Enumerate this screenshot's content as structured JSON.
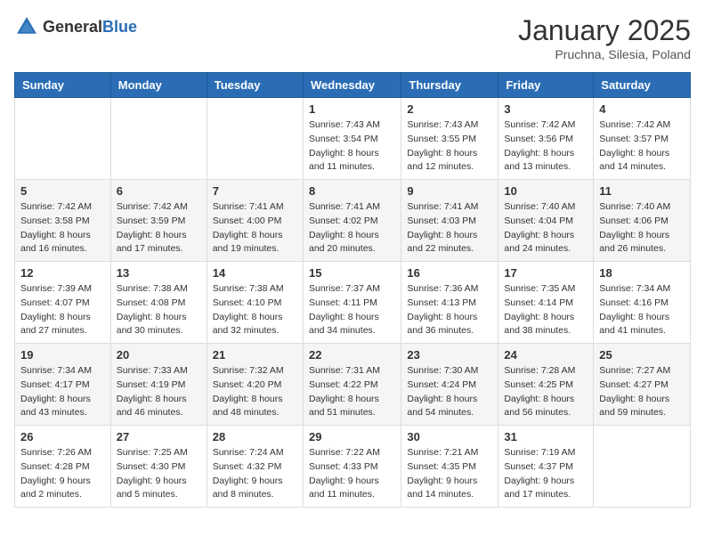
{
  "header": {
    "logo_general": "General",
    "logo_blue": "Blue",
    "title": "January 2025",
    "location": "Pruchna, Silesia, Poland"
  },
  "weekdays": [
    "Sunday",
    "Monday",
    "Tuesday",
    "Wednesday",
    "Thursday",
    "Friday",
    "Saturday"
  ],
  "weeks": [
    [
      {
        "day": "",
        "info": ""
      },
      {
        "day": "",
        "info": ""
      },
      {
        "day": "",
        "info": ""
      },
      {
        "day": "1",
        "info": "Sunrise: 7:43 AM\nSunset: 3:54 PM\nDaylight: 8 hours\nand 11 minutes."
      },
      {
        "day": "2",
        "info": "Sunrise: 7:43 AM\nSunset: 3:55 PM\nDaylight: 8 hours\nand 12 minutes."
      },
      {
        "day": "3",
        "info": "Sunrise: 7:42 AM\nSunset: 3:56 PM\nDaylight: 8 hours\nand 13 minutes."
      },
      {
        "day": "4",
        "info": "Sunrise: 7:42 AM\nSunset: 3:57 PM\nDaylight: 8 hours\nand 14 minutes."
      }
    ],
    [
      {
        "day": "5",
        "info": "Sunrise: 7:42 AM\nSunset: 3:58 PM\nDaylight: 8 hours\nand 16 minutes."
      },
      {
        "day": "6",
        "info": "Sunrise: 7:42 AM\nSunset: 3:59 PM\nDaylight: 8 hours\nand 17 minutes."
      },
      {
        "day": "7",
        "info": "Sunrise: 7:41 AM\nSunset: 4:00 PM\nDaylight: 8 hours\nand 19 minutes."
      },
      {
        "day": "8",
        "info": "Sunrise: 7:41 AM\nSunset: 4:02 PM\nDaylight: 8 hours\nand 20 minutes."
      },
      {
        "day": "9",
        "info": "Sunrise: 7:41 AM\nSunset: 4:03 PM\nDaylight: 8 hours\nand 22 minutes."
      },
      {
        "day": "10",
        "info": "Sunrise: 7:40 AM\nSunset: 4:04 PM\nDaylight: 8 hours\nand 24 minutes."
      },
      {
        "day": "11",
        "info": "Sunrise: 7:40 AM\nSunset: 4:06 PM\nDaylight: 8 hours\nand 26 minutes."
      }
    ],
    [
      {
        "day": "12",
        "info": "Sunrise: 7:39 AM\nSunset: 4:07 PM\nDaylight: 8 hours\nand 27 minutes."
      },
      {
        "day": "13",
        "info": "Sunrise: 7:38 AM\nSunset: 4:08 PM\nDaylight: 8 hours\nand 30 minutes."
      },
      {
        "day": "14",
        "info": "Sunrise: 7:38 AM\nSunset: 4:10 PM\nDaylight: 8 hours\nand 32 minutes."
      },
      {
        "day": "15",
        "info": "Sunrise: 7:37 AM\nSunset: 4:11 PM\nDaylight: 8 hours\nand 34 minutes."
      },
      {
        "day": "16",
        "info": "Sunrise: 7:36 AM\nSunset: 4:13 PM\nDaylight: 8 hours\nand 36 minutes."
      },
      {
        "day": "17",
        "info": "Sunrise: 7:35 AM\nSunset: 4:14 PM\nDaylight: 8 hours\nand 38 minutes."
      },
      {
        "day": "18",
        "info": "Sunrise: 7:34 AM\nSunset: 4:16 PM\nDaylight: 8 hours\nand 41 minutes."
      }
    ],
    [
      {
        "day": "19",
        "info": "Sunrise: 7:34 AM\nSunset: 4:17 PM\nDaylight: 8 hours\nand 43 minutes."
      },
      {
        "day": "20",
        "info": "Sunrise: 7:33 AM\nSunset: 4:19 PM\nDaylight: 8 hours\nand 46 minutes."
      },
      {
        "day": "21",
        "info": "Sunrise: 7:32 AM\nSunset: 4:20 PM\nDaylight: 8 hours\nand 48 minutes."
      },
      {
        "day": "22",
        "info": "Sunrise: 7:31 AM\nSunset: 4:22 PM\nDaylight: 8 hours\nand 51 minutes."
      },
      {
        "day": "23",
        "info": "Sunrise: 7:30 AM\nSunset: 4:24 PM\nDaylight: 8 hours\nand 54 minutes."
      },
      {
        "day": "24",
        "info": "Sunrise: 7:28 AM\nSunset: 4:25 PM\nDaylight: 8 hours\nand 56 minutes."
      },
      {
        "day": "25",
        "info": "Sunrise: 7:27 AM\nSunset: 4:27 PM\nDaylight: 8 hours\nand 59 minutes."
      }
    ],
    [
      {
        "day": "26",
        "info": "Sunrise: 7:26 AM\nSunset: 4:28 PM\nDaylight: 9 hours\nand 2 minutes."
      },
      {
        "day": "27",
        "info": "Sunrise: 7:25 AM\nSunset: 4:30 PM\nDaylight: 9 hours\nand 5 minutes."
      },
      {
        "day": "28",
        "info": "Sunrise: 7:24 AM\nSunset: 4:32 PM\nDaylight: 9 hours\nand 8 minutes."
      },
      {
        "day": "29",
        "info": "Sunrise: 7:22 AM\nSunset: 4:33 PM\nDaylight: 9 hours\nand 11 minutes."
      },
      {
        "day": "30",
        "info": "Sunrise: 7:21 AM\nSunset: 4:35 PM\nDaylight: 9 hours\nand 14 minutes."
      },
      {
        "day": "31",
        "info": "Sunrise: 7:19 AM\nSunset: 4:37 PM\nDaylight: 9 hours\nand 17 minutes."
      },
      {
        "day": "",
        "info": ""
      }
    ]
  ]
}
